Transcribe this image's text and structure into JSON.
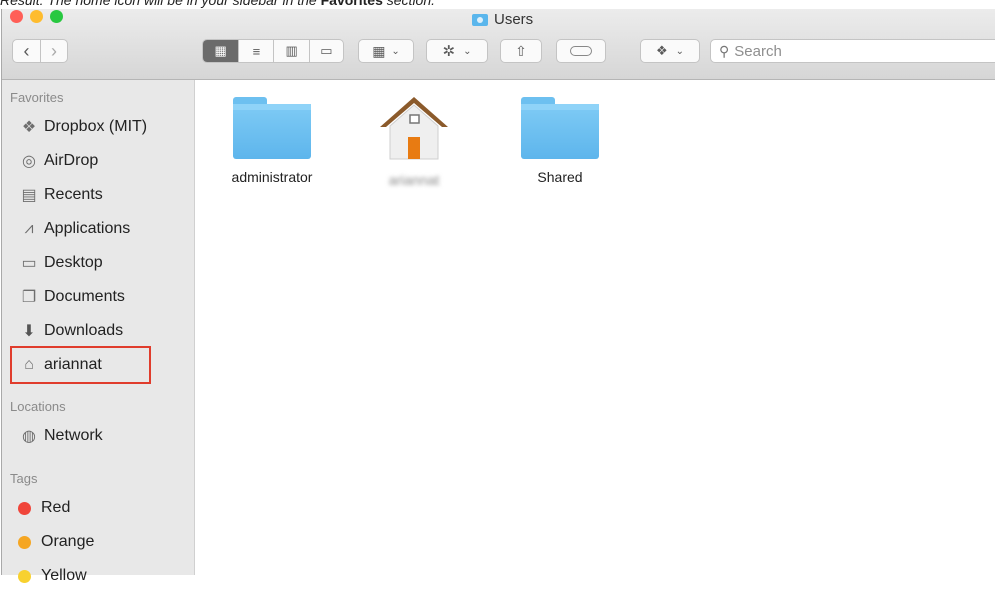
{
  "caption": {
    "prefix": "Result:",
    "middle": " The home icon will be in your sidebar in the ",
    "bold": "Favorites",
    "suffix": " section."
  },
  "window": {
    "title": "Users",
    "traffic_lights": [
      "#ff5f57",
      "#febc2e",
      "#28c840"
    ]
  },
  "toolbar": {
    "back_icon": "chevron-left",
    "forward_icon": "chevron-right",
    "view_modes": [
      "icons",
      "list",
      "columns",
      "gallery"
    ],
    "active_view": "icons",
    "search_placeholder": "Search"
  },
  "sidebar": {
    "favorites_header": "Favorites",
    "favorites": [
      {
        "label": "Dropbox (MIT)",
        "icon": "dropbox-icon"
      },
      {
        "label": "AirDrop",
        "icon": "airdrop-icon"
      },
      {
        "label": "Recents",
        "icon": "recents-icon"
      },
      {
        "label": "Applications",
        "icon": "applications-icon"
      },
      {
        "label": "Desktop",
        "icon": "desktop-icon"
      },
      {
        "label": "Documents",
        "icon": "documents-icon"
      },
      {
        "label": "Downloads",
        "icon": "downloads-icon"
      },
      {
        "label": "ariannat",
        "icon": "home-icon",
        "highlighted": true
      }
    ],
    "locations_header": "Locations",
    "locations": [
      {
        "label": "Network",
        "icon": "network-icon"
      }
    ],
    "tags_header": "Tags",
    "tags": [
      {
        "label": "Red",
        "color": "#f0453a"
      },
      {
        "label": "Orange",
        "color": "#f5a623"
      },
      {
        "label": "Yellow",
        "color": "#f8d12f"
      }
    ]
  },
  "files": [
    {
      "label": "administrator",
      "icon": "folder-icon"
    },
    {
      "label": "ariannat",
      "icon": "home-folder-icon",
      "blurred": true
    },
    {
      "label": "Shared",
      "icon": "folder-icon"
    }
  ]
}
